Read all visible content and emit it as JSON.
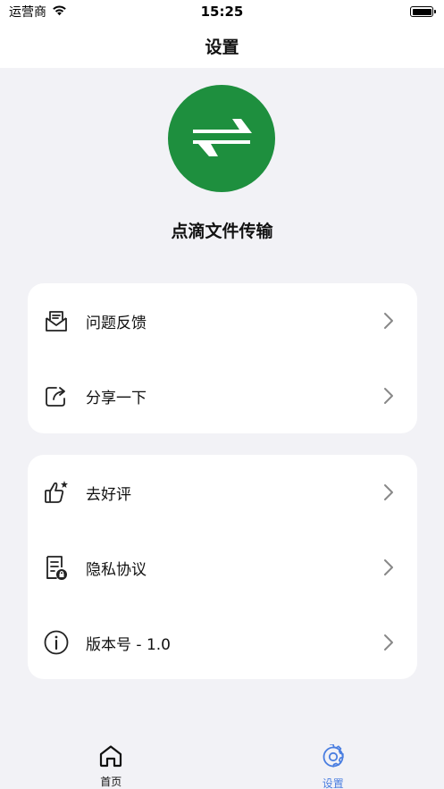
{
  "status_bar": {
    "carrier": "运营商",
    "time": "15:25"
  },
  "nav": {
    "title": "设置"
  },
  "app": {
    "name": "点滴文件传输",
    "logo_color": "#1e8f3e"
  },
  "groups": [
    {
      "items": [
        {
          "label": "问题反馈",
          "icon": "mail-feedback-icon"
        },
        {
          "label": "分享一下",
          "icon": "share-icon"
        }
      ]
    },
    {
      "items": [
        {
          "label": "去好评",
          "icon": "thumbs-up-star-icon"
        },
        {
          "label": "隐私协议",
          "icon": "privacy-document-icon"
        },
        {
          "label": "版本号 - 1.0",
          "icon": "info-icon"
        }
      ]
    }
  ],
  "tabs": [
    {
      "label": "首页",
      "icon": "home-icon",
      "active": false
    },
    {
      "label": "设置",
      "icon": "gear-icon",
      "active": true
    }
  ],
  "colors": {
    "accent": "#4a7ee0",
    "background": "#f2f2f6"
  }
}
